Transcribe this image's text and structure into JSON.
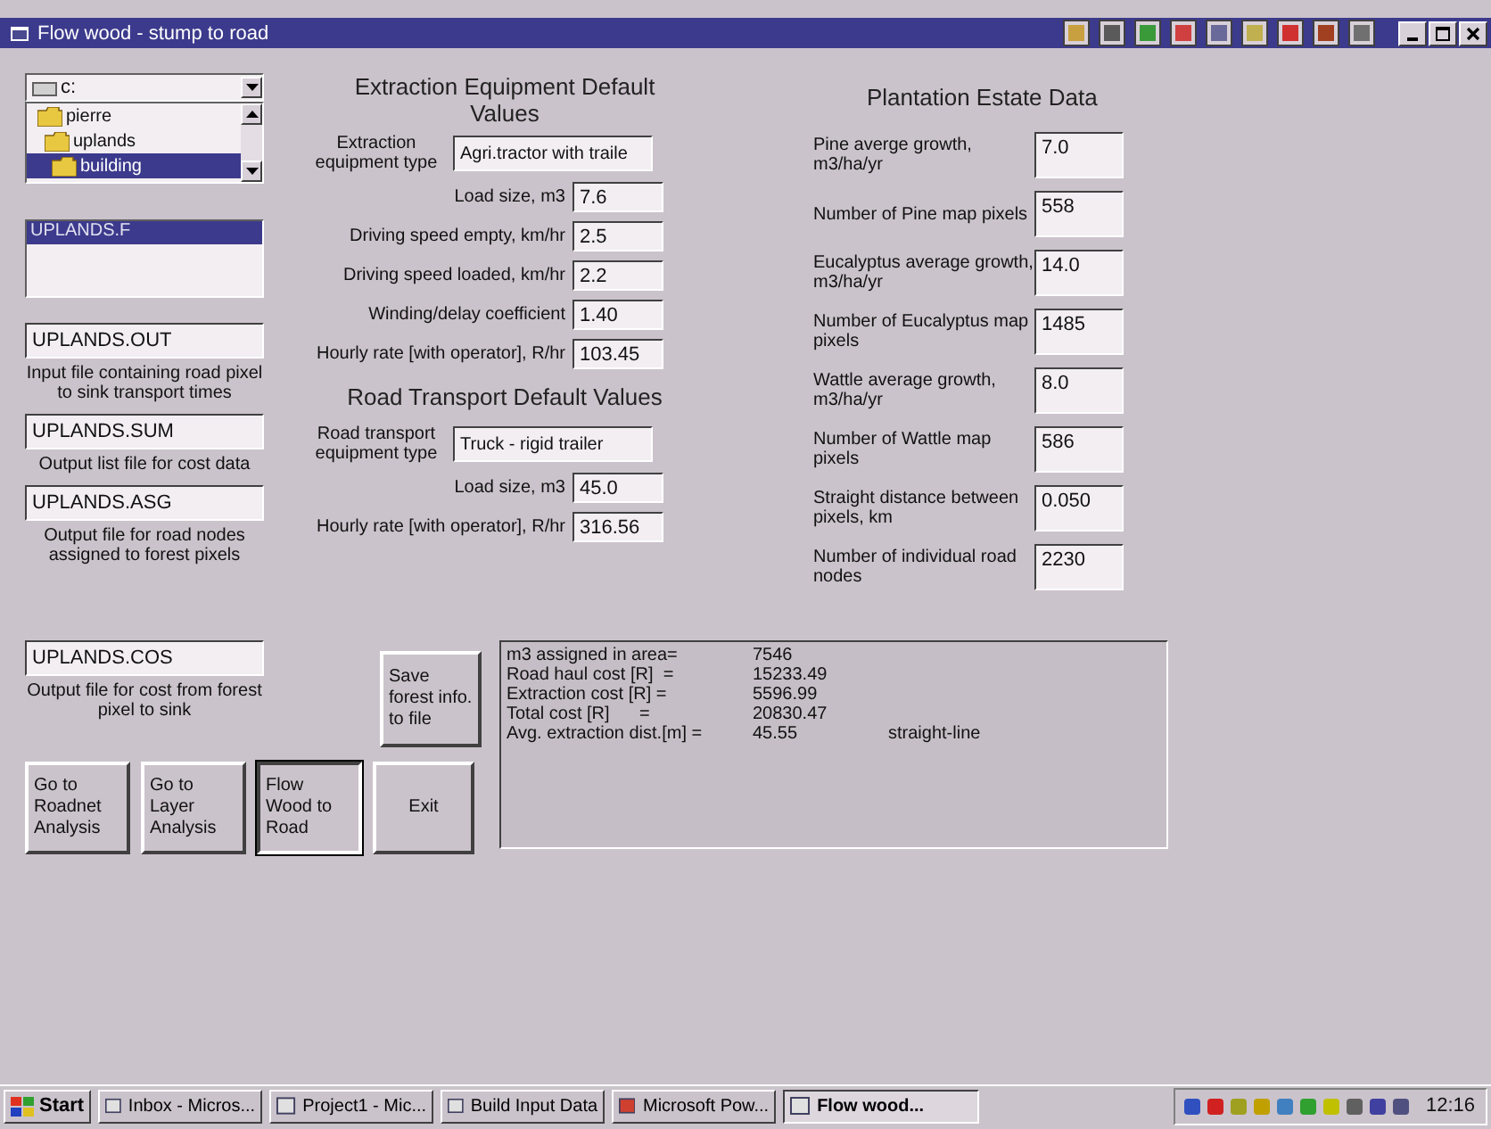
{
  "window": {
    "title": "Flow wood - stump to road"
  },
  "drive": {
    "value": "c:"
  },
  "folders": [
    {
      "name": "pierre",
      "selected": false,
      "children": [
        {
          "name": "uplands",
          "selected": false,
          "children": [
            {
              "name": "building",
              "selected": true
            }
          ]
        }
      ]
    }
  ],
  "files": [
    {
      "name": "UPLANDS.F",
      "selected": true
    }
  ],
  "file_fields": [
    {
      "value": "UPLANDS.OUT",
      "caption": "Input file containing road pixel to sink transport times"
    },
    {
      "value": "UPLANDS.SUM",
      "caption": "Output list file for cost data"
    },
    {
      "value": "UPLANDS.ASG",
      "caption": "Output file for road nodes assigned to forest pixels"
    },
    {
      "value": "UPLANDS.COS",
      "caption": "Output file for cost from forest pixel to sink"
    }
  ],
  "extraction": {
    "title": "Extraction Equipment Default Values",
    "type_label": "Extraction equipment type",
    "type_value": "Agri.tractor with traile",
    "fields": [
      {
        "label": "Load size, m3",
        "value": "7.6"
      },
      {
        "label": "Driving speed empty, km/hr",
        "value": "2.5"
      },
      {
        "label": "Driving speed loaded, km/hr",
        "value": "2.2"
      },
      {
        "label": "Winding/delay coefficient",
        "value": "1.40"
      },
      {
        "label": "Hourly rate [with operator], R/hr",
        "value": "103.45"
      }
    ]
  },
  "road": {
    "title": "Road Transport Default Values",
    "type_label": "Road transport equipment type",
    "type_value": "Truck - rigid trailer",
    "fields": [
      {
        "label": "Load size, m3",
        "value": "45.0"
      },
      {
        "label": "Hourly rate [with operator], R/hr",
        "value": "316.56"
      }
    ]
  },
  "plantation": {
    "title": "Plantation Estate Data",
    "fields": [
      {
        "label": "Pine averge growth, m3/ha/yr",
        "value": "7.0"
      },
      {
        "label": "Number of Pine map pixels",
        "value": "558"
      },
      {
        "label": "Eucalyptus average growth, m3/ha/yr",
        "value": "14.0"
      },
      {
        "label": "Number of Eucalyptus map pixels",
        "value": "1485"
      },
      {
        "label": "Wattle average growth, m3/ha/yr",
        "value": "8.0"
      },
      {
        "label": "Number of Wattle map pixels",
        "value": "586"
      },
      {
        "label": "Straight distance between pixels, km",
        "value": "0.050"
      },
      {
        "label": "Number of individual road nodes",
        "value": "2230"
      }
    ]
  },
  "save_button": "Save forest info. to file",
  "results": [
    {
      "label": "m3 assigned in area=",
      "value": "7546"
    },
    {
      "label": "Road haul cost [R]  =",
      "value": "15233.49"
    },
    {
      "label": "Extraction cost [R] =",
      "value": "5596.99"
    },
    {
      "label": "Total cost [R]      =",
      "value": "20830.47"
    },
    {
      "label": "Avg. extraction dist.[m] =",
      "value": "45.55",
      "note": "straight-line"
    }
  ],
  "buttons": [
    {
      "label": "Go to Roadnet Analysis",
      "selected": false
    },
    {
      "label": "Go to Layer Analysis",
      "selected": false
    },
    {
      "label": "Flow Wood to Road",
      "selected": true
    },
    {
      "label": "Exit",
      "selected": false
    }
  ],
  "taskbar": {
    "start": "Start",
    "clock": "12:16",
    "items": [
      {
        "label": "Inbox - Micros...",
        "selected": false
      },
      {
        "label": "Project1 - Mic...",
        "selected": false
      },
      {
        "label": "Build Input Data",
        "selected": false
      },
      {
        "label": "Microsoft Pow...",
        "selected": false
      },
      {
        "label": "Flow wood...",
        "selected": true
      }
    ]
  }
}
